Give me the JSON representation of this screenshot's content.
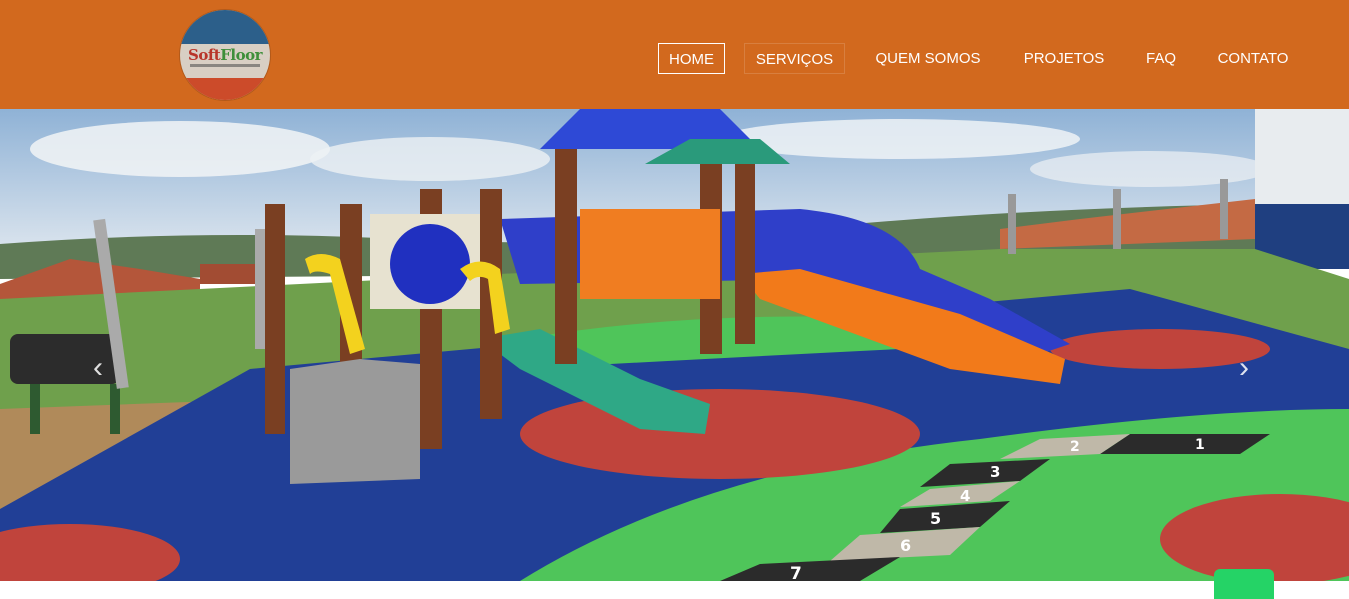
{
  "brand": {
    "logo_text_part1": "Soft",
    "logo_text_part2": "Floor"
  },
  "nav": {
    "items": [
      {
        "label": "HOME",
        "state": "active"
      },
      {
        "label": "SERVIÇOS",
        "state": "hover"
      },
      {
        "label": "QUEM SOMOS",
        "state": "normal"
      },
      {
        "label": "PROJETOS",
        "state": "normal"
      },
      {
        "label": "FAQ",
        "state": "normal"
      },
      {
        "label": "CONTATO",
        "state": "normal"
      }
    ]
  },
  "hero": {
    "prev_icon": "chevron-left-icon",
    "next_icon": "chevron-right-icon",
    "hopscotch_numbers": [
      "1",
      "2",
      "3",
      "4",
      "5",
      "6",
      "7"
    ]
  },
  "colors": {
    "header_bg": "#d2691e",
    "whatsapp": "#25d366"
  }
}
